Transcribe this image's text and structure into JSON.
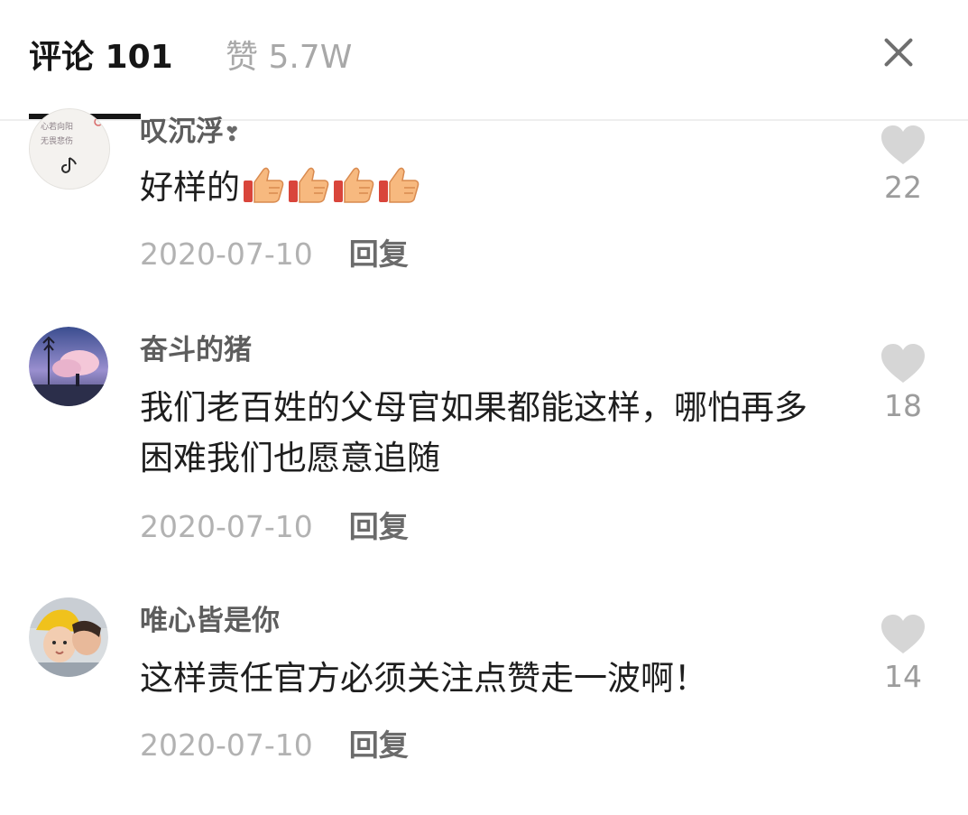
{
  "header": {
    "tab_comments": "评论 101",
    "tab_likes": "赞 5.7W",
    "close_icon": "close-icon"
  },
  "comments": [
    {
      "username": "叹沉浮",
      "username_badge": "❣",
      "text": "好样的",
      "emoji": [
        "thumbs-up-icon",
        "thumbs-up-icon",
        "thumbs-up-icon",
        "thumbs-up-icon"
      ],
      "date": "2020-07-10",
      "reply_label": "回复",
      "like_count": "22",
      "avatar_text": "心若向阳，无畏悲伤"
    },
    {
      "username": "奋斗的猪",
      "text": "我们老百姓的父母官如果都能这样，哪怕再多困难我们也愿意追随",
      "date": "2020-07-10",
      "reply_label": "回复",
      "like_count": "18"
    },
    {
      "username": "唯心皆是你",
      "text": "这样责任官方必须关注点赞走一波啊！",
      "date": "2020-07-10",
      "reply_label": "回复",
      "like_count": "14"
    }
  ],
  "colors": {
    "primary_text": "#1e1e1e",
    "secondary_text": "#b2b2b2",
    "like_icon": "#d6d6d6"
  }
}
